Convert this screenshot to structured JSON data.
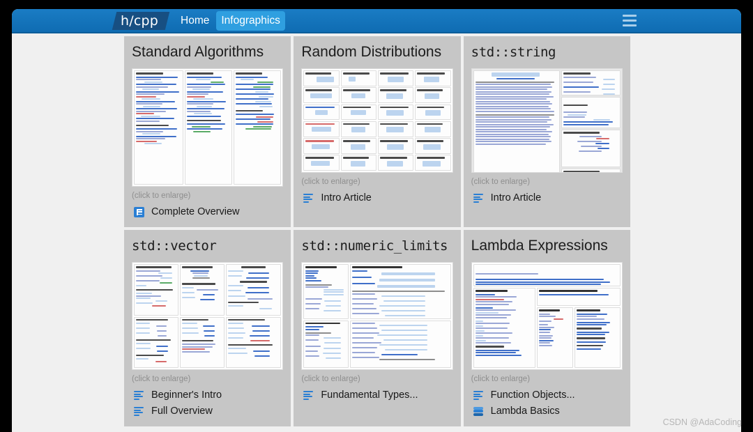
{
  "window": {
    "background_color": "#f0f0f0",
    "outer_background": "#000000"
  },
  "navbar": {
    "logo": "h/cpp",
    "accent_color": "#1274bd",
    "active_color": "#2f9fe0",
    "links": [
      {
        "label": "Home",
        "active": false
      },
      {
        "label": "Infographics",
        "active": true
      }
    ],
    "menu_icon": "hamburger-icon"
  },
  "cards": [
    {
      "title": "Standard Algorithms",
      "title_mono": false,
      "thumbnail": "standard-algorithms-infographic",
      "caption": "(click to enlarge)",
      "links": [
        {
          "label": "Complete Overview",
          "icon": "table-icon"
        }
      ]
    },
    {
      "title": "Random Distributions",
      "title_mono": false,
      "thumbnail": "random-distributions-infographic",
      "caption": "(click to enlarge)",
      "links": [
        {
          "label": "Intro Article",
          "icon": "article-icon"
        }
      ]
    },
    {
      "title": "std::string",
      "title_mono": true,
      "thumbnail": "std-string-infographic",
      "caption": "(click to enlarge)",
      "links": [
        {
          "label": "Intro Article",
          "icon": "article-icon"
        }
      ]
    },
    {
      "title": "std::vector",
      "title_mono": true,
      "thumbnail": "std-vector-infographic",
      "caption": "(click to enlarge)",
      "links": [
        {
          "label": "Beginner's Intro",
          "icon": "article-icon"
        },
        {
          "label": "Full Overview",
          "icon": "article-icon"
        }
      ]
    },
    {
      "title": "std::numeric_limits",
      "title_mono": true,
      "thumbnail": "std-numeric-limits-infographic",
      "caption": "(click to enlarge)",
      "links": [
        {
          "label": "Fundamental Types...",
          "icon": "article-icon"
        }
      ]
    },
    {
      "title": "Lambda Expressions",
      "title_mono": false,
      "thumbnail": "lambda-expressions-infographic",
      "caption": "(click to enlarge)",
      "links": [
        {
          "label": "Function Objects...",
          "icon": "article-icon"
        },
        {
          "label": "Lambda Basics",
          "icon": "stack-icon"
        }
      ]
    }
  ],
  "watermark": "CSDN @AdaCoding"
}
